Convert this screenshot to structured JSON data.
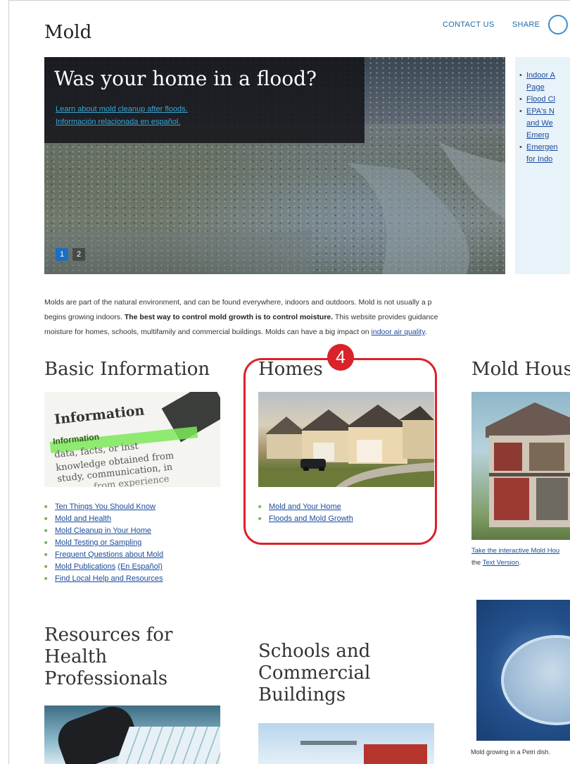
{
  "header": {
    "page_title": "Mold",
    "contact_label": "CONTACT US",
    "share_label": "SHARE"
  },
  "hero": {
    "title": "Was your home in a flood?",
    "link_1": "Learn about mold cleanup after floods.",
    "link_2": "Información relacionada en español.",
    "pager": [
      "1",
      "2"
    ]
  },
  "sidebar": {
    "items": [
      "Indoor A Page",
      "Flood Cl",
      "EPA's N and We Emerg",
      "Emergen for Indo"
    ]
  },
  "intro": {
    "line1": "Molds are part of the natural environment, and can be found everywhere, indoors and outdoors. Mold is not usually a p",
    "line2_a": "begins growing indoors. ",
    "line2_b": "The best way to control mold growth is to control moisture.",
    "line2_c": " This website provides guidance",
    "line3_a": "moisture for homes, schools, multifamily and commercial buildings. Molds can have a big impact on ",
    "line3_link": "indoor air quality",
    "line3_end": "."
  },
  "basic_info": {
    "heading": "Basic Information",
    "image_words": [
      "Information",
      "Information",
      "data, facts, or inst",
      "knowledge obtained from",
      "study, communication, in",
      "from experience"
    ],
    "links": [
      "Ten Things You Should Know",
      "Mold and Health",
      "Mold Cleanup in Your Home",
      "Mold Testing or Sampling",
      "Frequent Questions about Mold",
      "Mold Publications",
      "Find Local Help and Resources"
    ],
    "publications_extra": "(En Español)"
  },
  "homes": {
    "heading": "Homes",
    "links": [
      "Mold and Your Home",
      "Floods and Mold Growth"
    ],
    "badge": "4"
  },
  "mold_house": {
    "heading": "Mold Hous",
    "caption_line1": "Take the interactive Mold Hou",
    "caption_line2_a": "the ",
    "caption_line2_link": "Text Version",
    "caption_line2_b": "."
  },
  "resources": {
    "heading_lines": [
      "Resources for",
      "Health",
      "Professionals"
    ]
  },
  "schools": {
    "heading_lines": [
      "Schools and",
      "Commercial",
      "Buildings"
    ]
  },
  "petri": {
    "caption": "Mold growing in a Petri dish."
  }
}
